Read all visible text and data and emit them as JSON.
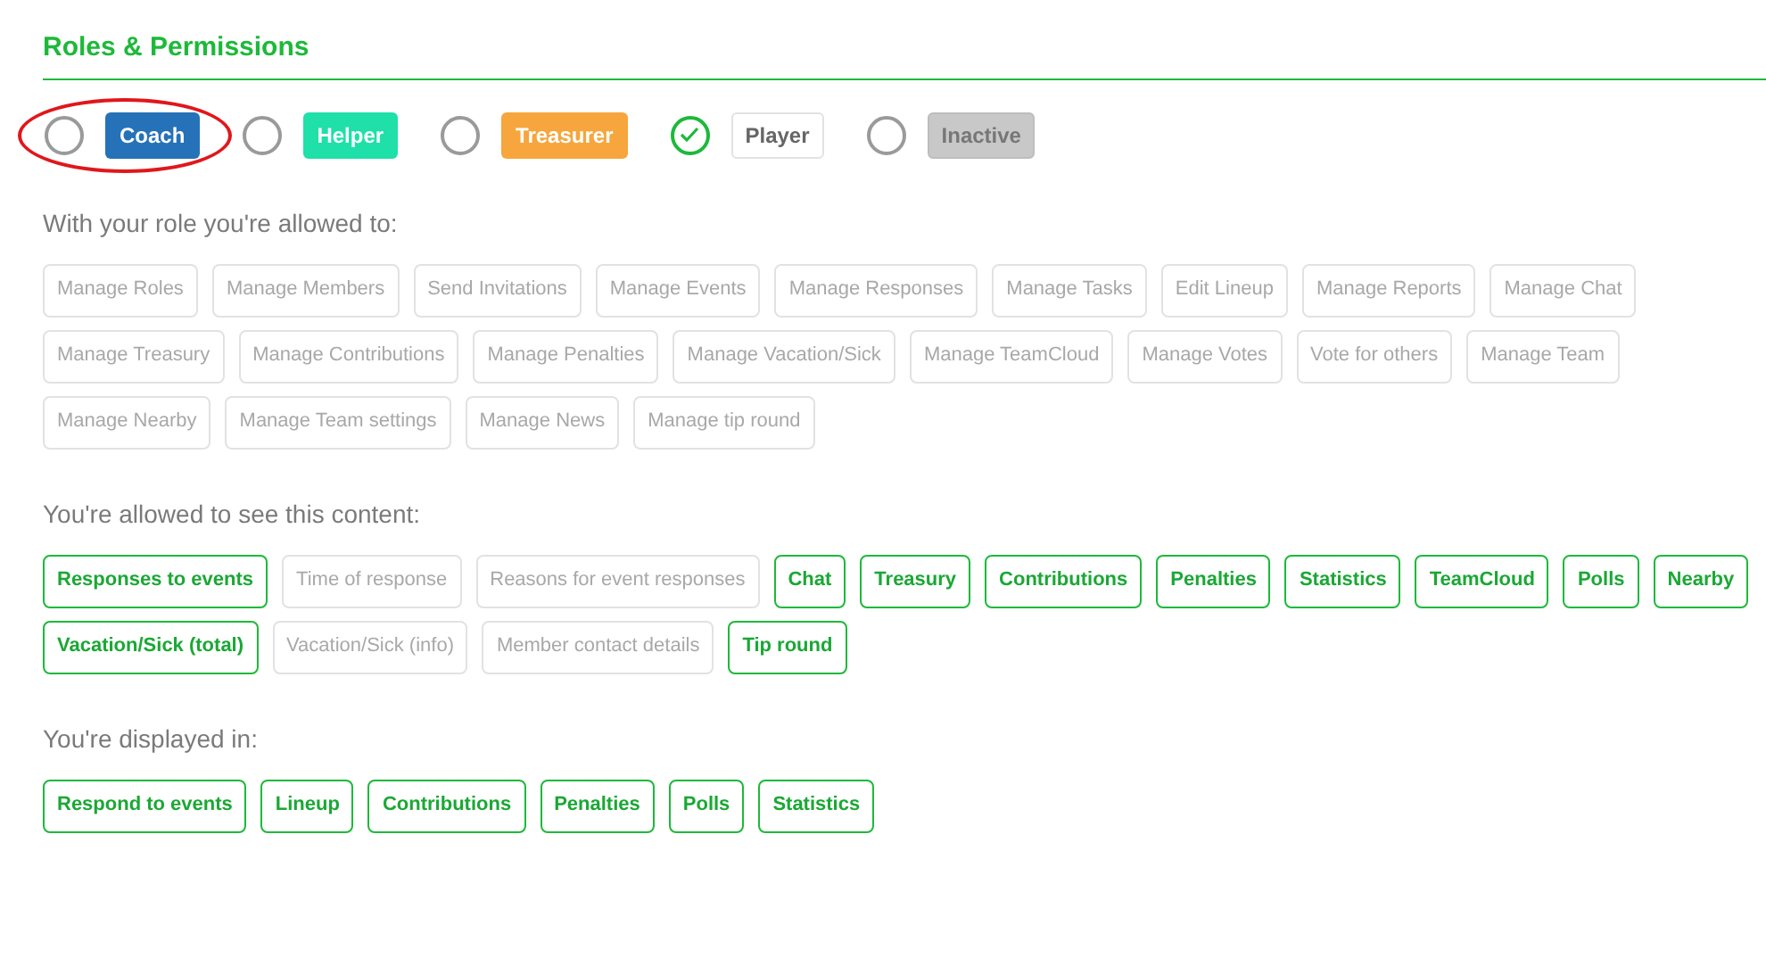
{
  "section_title": "Roles & Permissions",
  "roles": [
    {
      "label": "Coach",
      "checked": false,
      "highlighted": true,
      "kind": "filled",
      "color": "#2672b8"
    },
    {
      "label": "Helper",
      "checked": false,
      "highlighted": false,
      "kind": "filled",
      "color": "#1ee0a8"
    },
    {
      "label": "Treasurer",
      "checked": false,
      "highlighted": false,
      "kind": "filled",
      "color": "#f6a63c"
    },
    {
      "label": "Player",
      "checked": true,
      "highlighted": false,
      "kind": "outline",
      "color": "#ffffff"
    },
    {
      "label": "Inactive",
      "checked": false,
      "highlighted": false,
      "kind": "muted",
      "color": "#c8c8c8"
    }
  ],
  "groups": [
    {
      "heading": "With your role you're allowed to:",
      "items": [
        {
          "label": "Manage Roles",
          "allowed": false
        },
        {
          "label": "Manage Members",
          "allowed": false
        },
        {
          "label": "Send Invitations",
          "allowed": false
        },
        {
          "label": "Manage Events",
          "allowed": false
        },
        {
          "label": "Manage Responses",
          "allowed": false
        },
        {
          "label": "Manage Tasks",
          "allowed": false
        },
        {
          "label": "Edit Lineup",
          "allowed": false
        },
        {
          "label": "Manage Reports",
          "allowed": false
        },
        {
          "label": "Manage Chat",
          "allowed": false
        },
        {
          "label": "Manage Treasury",
          "allowed": false
        },
        {
          "label": "Manage Contributions",
          "allowed": false
        },
        {
          "label": "Manage Penalties",
          "allowed": false
        },
        {
          "label": "Manage Vacation/Sick",
          "allowed": false
        },
        {
          "label": "Manage TeamCloud",
          "allowed": false
        },
        {
          "label": "Manage Votes",
          "allowed": false
        },
        {
          "label": "Vote for others",
          "allowed": false
        },
        {
          "label": "Manage Team",
          "allowed": false
        },
        {
          "label": "Manage Nearby",
          "allowed": false
        },
        {
          "label": "Manage Team settings",
          "allowed": false
        },
        {
          "label": "Manage News",
          "allowed": false
        },
        {
          "label": "Manage tip round",
          "allowed": false
        }
      ]
    },
    {
      "heading": "You're allowed to see this content:",
      "items": [
        {
          "label": "Responses to events",
          "allowed": true
        },
        {
          "label": "Time of response",
          "allowed": false
        },
        {
          "label": "Reasons for event responses",
          "allowed": false
        },
        {
          "label": "Chat",
          "allowed": true
        },
        {
          "label": "Treasury",
          "allowed": true
        },
        {
          "label": "Contributions",
          "allowed": true
        },
        {
          "label": "Penalties",
          "allowed": true
        },
        {
          "label": "Statistics",
          "allowed": true
        },
        {
          "label": "TeamCloud",
          "allowed": true
        },
        {
          "label": "Polls",
          "allowed": true
        },
        {
          "label": "Nearby",
          "allowed": true
        },
        {
          "label": "Vacation/Sick (total)",
          "allowed": true
        },
        {
          "label": "Vacation/Sick (info)",
          "allowed": false
        },
        {
          "label": "Member contact details",
          "allowed": false
        },
        {
          "label": "Tip round",
          "allowed": true
        }
      ]
    },
    {
      "heading": "You're displayed in:",
      "items": [
        {
          "label": "Respond to events",
          "allowed": true
        },
        {
          "label": "Lineup",
          "allowed": true
        },
        {
          "label": "Contributions",
          "allowed": true
        },
        {
          "label": "Penalties",
          "allowed": true
        },
        {
          "label": "Polls",
          "allowed": true
        },
        {
          "label": "Statistics",
          "allowed": true
        }
      ]
    }
  ]
}
